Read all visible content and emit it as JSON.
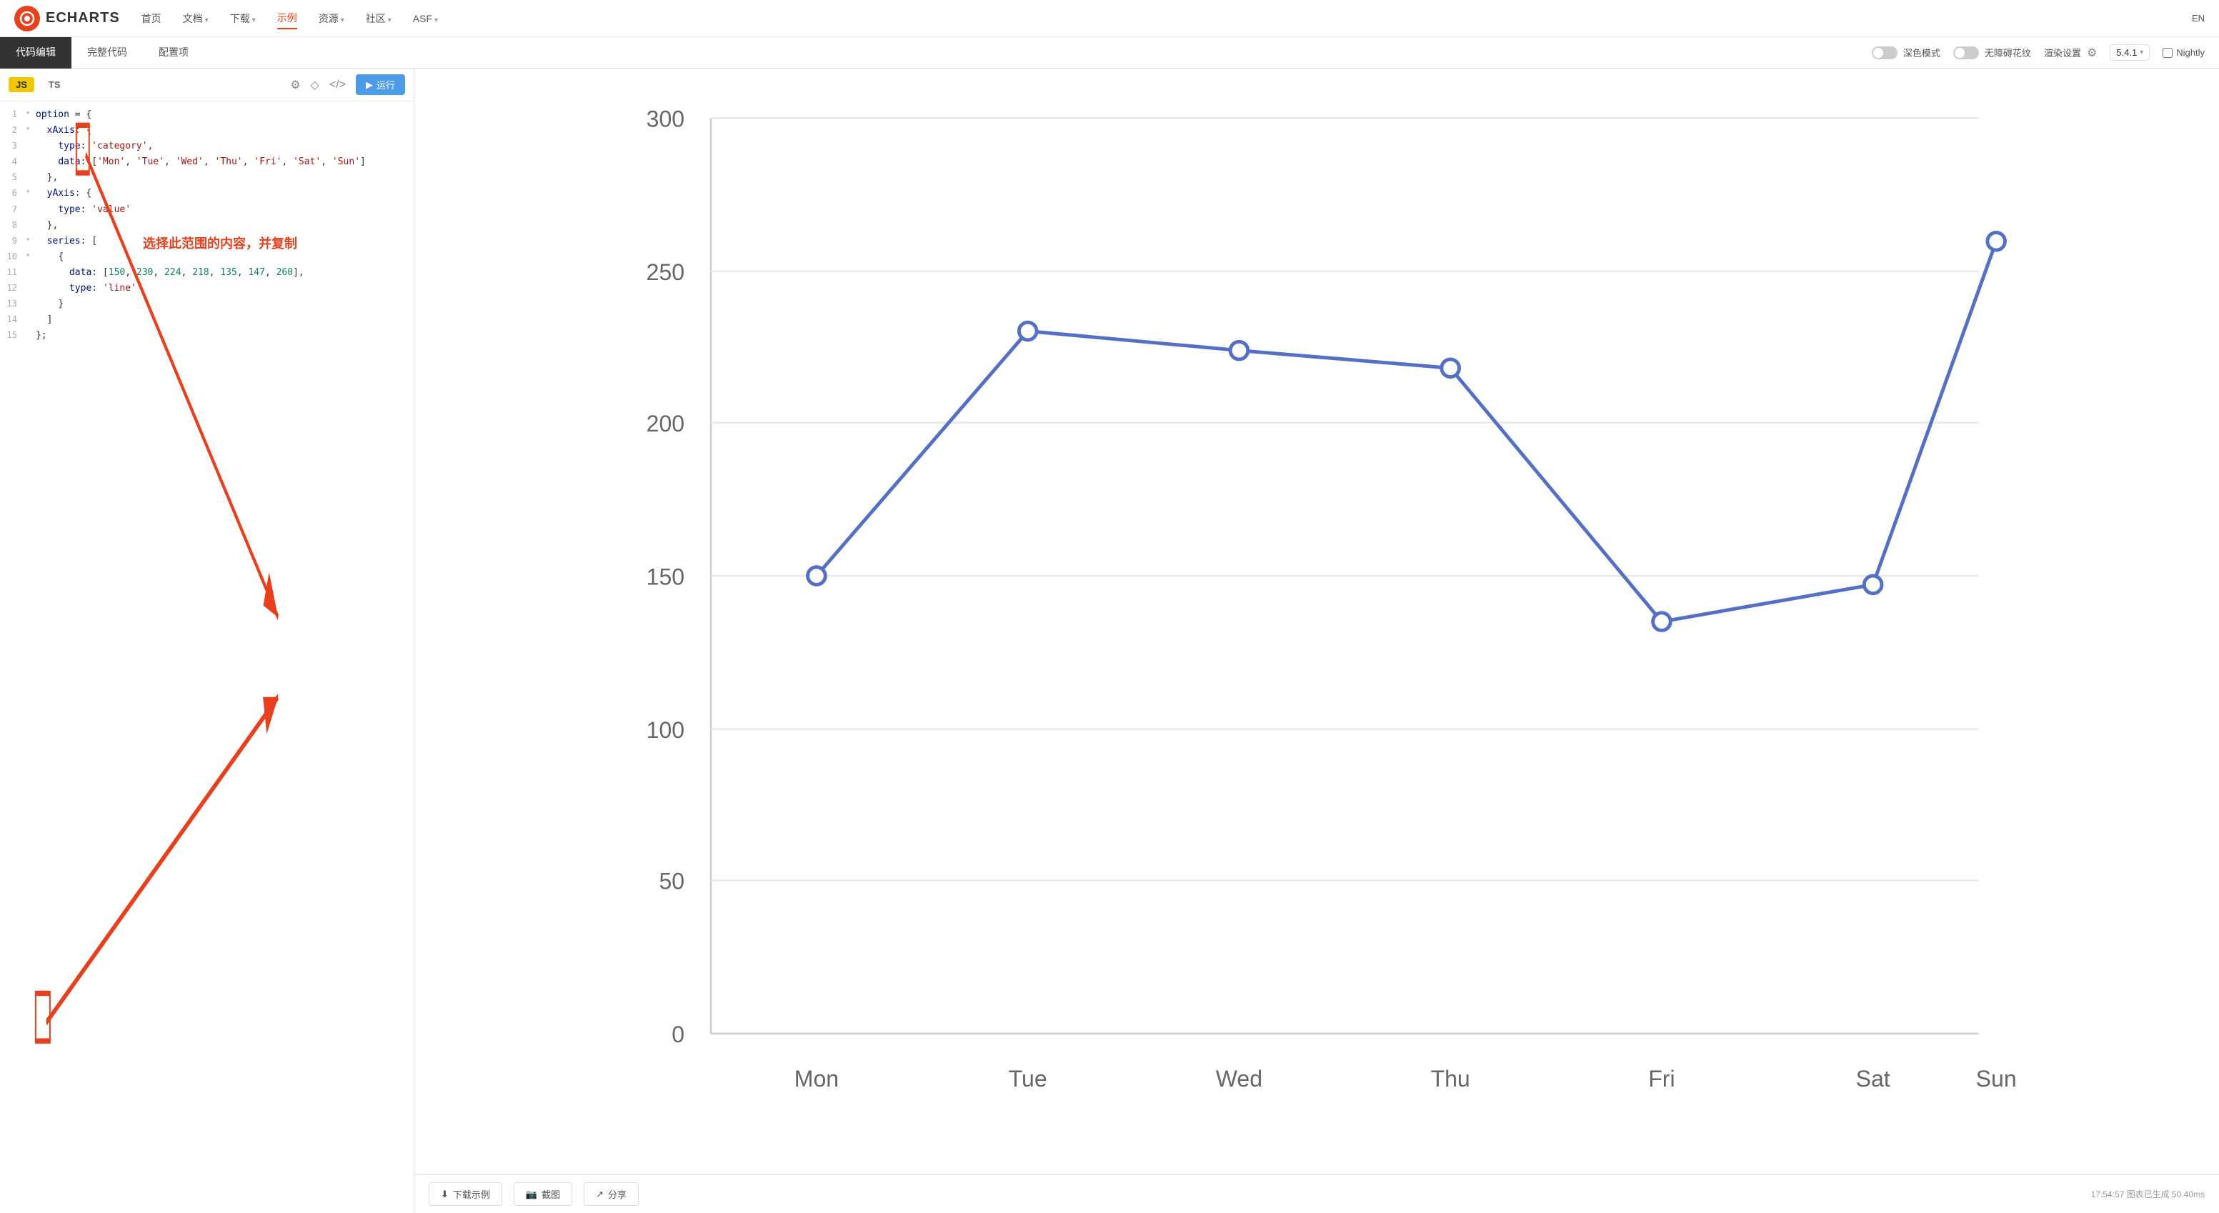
{
  "nav": {
    "logo_text": "ECHARTS",
    "items": [
      {
        "label": "首页",
        "active": false
      },
      {
        "label": "文档",
        "active": false,
        "arrow": true
      },
      {
        "label": "下载",
        "active": false,
        "arrow": true
      },
      {
        "label": "示例",
        "active": true
      },
      {
        "label": "资源",
        "active": false,
        "arrow": true
      },
      {
        "label": "社区",
        "active": false,
        "arrow": true
      },
      {
        "label": "ASF",
        "active": false,
        "arrow": true
      }
    ],
    "lang": "EN"
  },
  "second_bar": {
    "tabs": [
      {
        "label": "代码编辑",
        "active": true
      },
      {
        "label": "完整代码",
        "active": false
      },
      {
        "label": "配置项",
        "active": false
      }
    ],
    "dark_mode_label": "深色模式",
    "accessible_label": "无障碍花纹",
    "render_label": "渲染设置",
    "version": "5.4.1",
    "nightly_label": "Nightly"
  },
  "code_toolbar": {
    "js_label": "JS",
    "ts_label": "TS",
    "run_label": "运行"
  },
  "code_lines": [
    {
      "num": 1,
      "fold": true,
      "content": "option = {"
    },
    {
      "num": 2,
      "fold": true,
      "content": "  xAxis: {"
    },
    {
      "num": 3,
      "fold": false,
      "content": "    type: 'category',"
    },
    {
      "num": 4,
      "fold": false,
      "content": "    data: ['Mon', 'Tue', 'Wed', 'Thu', 'Fri', 'Sat', 'Sun']"
    },
    {
      "num": 5,
      "fold": false,
      "content": "  },"
    },
    {
      "num": 6,
      "fold": true,
      "content": "  yAxis: {"
    },
    {
      "num": 7,
      "fold": false,
      "content": "    type: 'value'"
    },
    {
      "num": 8,
      "fold": false,
      "content": "  },"
    },
    {
      "num": 9,
      "fold": true,
      "content": "  series: ["
    },
    {
      "num": 10,
      "fold": true,
      "content": "    {"
    },
    {
      "num": 11,
      "fold": false,
      "content": "      data: [150, 230, 224, 218, 135, 147, 260],"
    },
    {
      "num": 12,
      "fold": false,
      "content": "      type: 'line'"
    },
    {
      "num": 13,
      "fold": false,
      "content": "    }"
    },
    {
      "num": 14,
      "fold": false,
      "content": "  ]"
    },
    {
      "num": 15,
      "fold": false,
      "content": "};"
    }
  ],
  "annotation": {
    "text": "选择此范围的内容，并复制"
  },
  "chart": {
    "y_axis_labels": [
      "0",
      "50",
      "100",
      "150",
      "200",
      "250",
      "300"
    ],
    "x_axis_labels": [
      "Mon",
      "Tue",
      "Wed",
      "Thu",
      "Fri",
      "Sat",
      "Sun"
    ],
    "data_points": [
      150,
      230,
      224,
      218,
      135,
      147,
      260
    ],
    "y_min": 0,
    "y_max": 300
  },
  "bottom_bar": {
    "download_label": "下载示例",
    "screenshot_label": "截图",
    "share_label": "分享",
    "status": "17:54:57  图表已生成 50.40ms"
  }
}
